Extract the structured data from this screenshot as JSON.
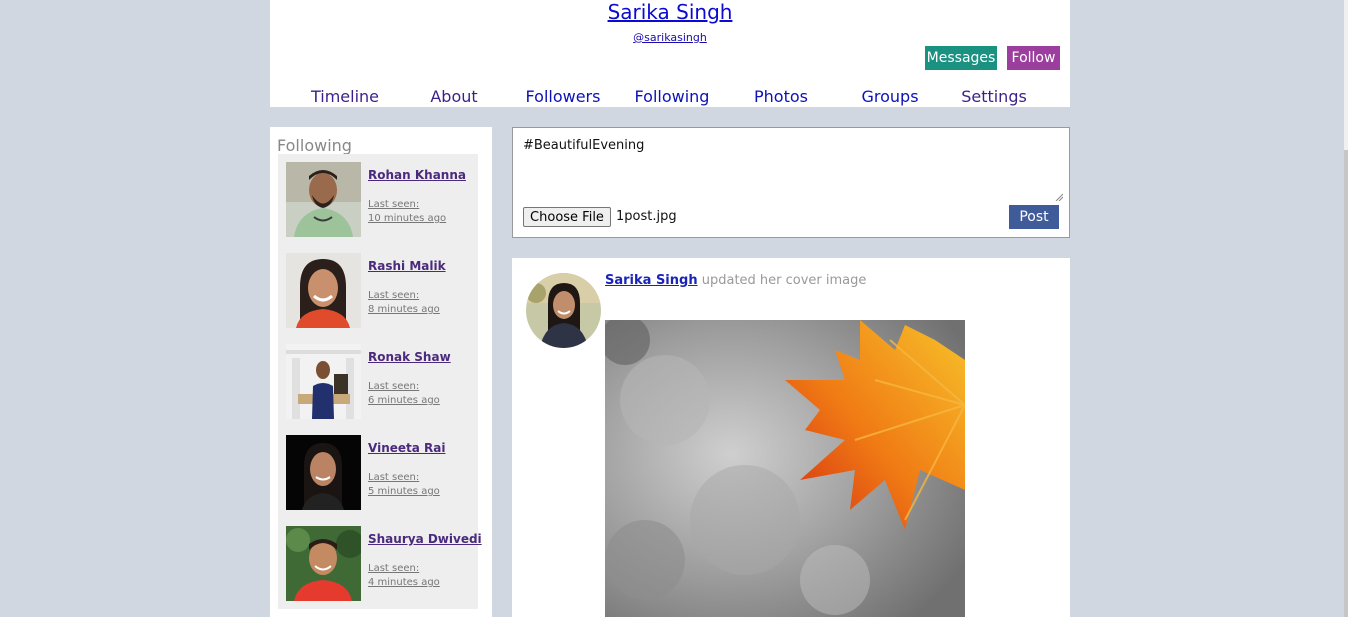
{
  "profile": {
    "name": "Sarika Singh",
    "handle": "@sarikasingh",
    "messages_label": "Messages",
    "follow_label": "Follow"
  },
  "nav": {
    "tabs": [
      {
        "label": "Timeline"
      },
      {
        "label": "About"
      },
      {
        "label": "Followers"
      },
      {
        "label": "Following"
      },
      {
        "label": "Photos"
      },
      {
        "label": "Groups"
      },
      {
        "label": "Settings"
      }
    ]
  },
  "sidebar": {
    "title": "Following",
    "items": [
      {
        "name": "Rohan Khanna",
        "last_seen_label": "Last seen:",
        "last_seen": "10 minutes ago"
      },
      {
        "name": "Rashi Malik",
        "last_seen_label": "Last seen:",
        "last_seen": "8 minutes ago"
      },
      {
        "name": "Ronak Shaw",
        "last_seen_label": "Last seen:",
        "last_seen": "6 minutes ago"
      },
      {
        "name": "Vineeta Rai",
        "last_seen_label": "Last seen:",
        "last_seen": "5 minutes ago"
      },
      {
        "name": "Shaurya Dwivedi",
        "last_seen_label": "Last seen:",
        "last_seen": "4 minutes ago"
      }
    ]
  },
  "composer": {
    "text": "#BeautifulEvening",
    "choose_file_label": "Choose File",
    "file_name": "1post.jpg",
    "post_label": "Post"
  },
  "feed": {
    "post": {
      "author": "Sarika Singh",
      "action": "updated her cover image"
    }
  },
  "colors": {
    "background": "#d1d7e0",
    "messages_button": "#1b9181",
    "follow_button": "#9c3e9e",
    "post_button": "#3f5b99"
  }
}
